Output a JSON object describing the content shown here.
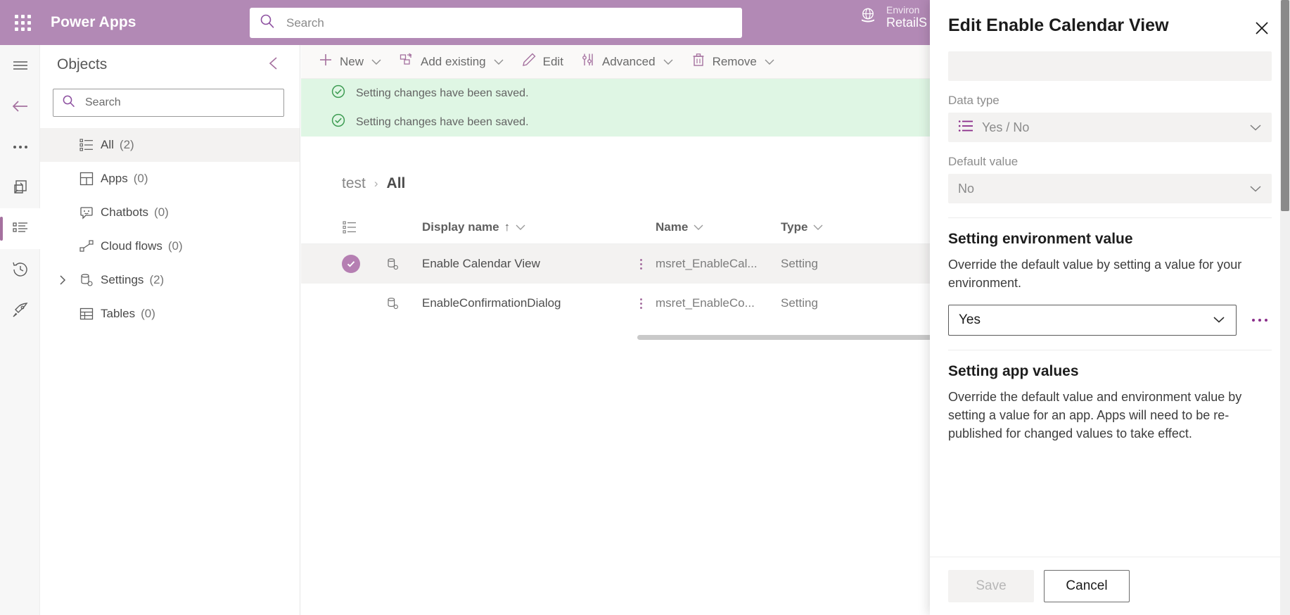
{
  "topbar": {
    "waffle_name": "app-launcher",
    "brand": "Power Apps",
    "search_placeholder": "Search",
    "search_value": "",
    "environment_label": "Environ",
    "environment_name": "RetailS",
    "accent": "#b289b5"
  },
  "rail": {
    "items": [
      {
        "name": "hamburger-menu",
        "label": "Menu"
      },
      {
        "name": "back-arrow",
        "label": "Back"
      },
      {
        "name": "more-ellipsis",
        "label": "More"
      },
      {
        "name": "solutions",
        "label": "Solutions"
      },
      {
        "name": "objects",
        "label": "Objects"
      },
      {
        "name": "history",
        "label": "History"
      },
      {
        "name": "publish-rocket",
        "label": "Publish"
      }
    ]
  },
  "objects_panel": {
    "title": "Objects",
    "collapse_icon": "chevron-left-icon",
    "search_placeholder": "Search",
    "search_value": "",
    "tree": [
      {
        "icon": "all-list-icon",
        "label": "All",
        "count": "(2)",
        "selected": true,
        "expandable": false
      },
      {
        "icon": "apps-grid-icon",
        "label": "Apps",
        "count": "(0)",
        "selected": false,
        "expandable": false
      },
      {
        "icon": "chatbot-icon",
        "label": "Chatbots",
        "count": "(0)",
        "selected": false,
        "expandable": false
      },
      {
        "icon": "cloud-flow-icon",
        "label": "Cloud flows",
        "count": "(0)",
        "selected": false,
        "expandable": false
      },
      {
        "icon": "settings-db-icon",
        "label": "Settings",
        "count": "(2)",
        "selected": false,
        "expandable": true
      },
      {
        "icon": "tables-icon",
        "label": "Tables",
        "count": "(0)",
        "selected": false,
        "expandable": false
      }
    ]
  },
  "command_bar": {
    "items": [
      {
        "icon": "plus-icon",
        "label": "New",
        "caret": true
      },
      {
        "icon": "add-existing-icon",
        "label": "Add existing",
        "caret": true
      },
      {
        "icon": "pencil-icon",
        "label": "Edit",
        "caret": false
      },
      {
        "icon": "advanced-icon",
        "label": "Advanced",
        "caret": true
      },
      {
        "icon": "trash-icon",
        "label": "Remove",
        "caret": true
      }
    ]
  },
  "notifications": [
    {
      "icon": "success-check-icon",
      "text": "Setting changes have been saved."
    },
    {
      "icon": "success-check-icon",
      "text": "Setting changes have been saved."
    }
  ],
  "breadcrumb": {
    "parent": "test",
    "separator": "›",
    "current": "All"
  },
  "grid": {
    "header_icon": "row-select-icon",
    "columns": [
      {
        "label": "Display name",
        "sort": "↑",
        "caret": true
      },
      {
        "label": "Name",
        "sort": "",
        "caret": true
      },
      {
        "label": "Type",
        "sort": "",
        "caret": true
      }
    ],
    "rows": [
      {
        "selected": true,
        "icon": "setting-record-icon",
        "display_name": "Enable Calendar View",
        "name": "msret_EnableCal...",
        "type": "Setting"
      },
      {
        "selected": false,
        "icon": "setting-record-icon",
        "display_name": "EnableConfirmationDialog",
        "name": "msret_EnableCo...",
        "type": "Setting"
      }
    ]
  },
  "panel": {
    "title": "Edit Enable Calendar View",
    "close_icon": "close-icon",
    "top_field_value": "",
    "data_type": {
      "label": "Data type",
      "icon": "yes-no-list-icon",
      "value": "Yes / No",
      "caret": "chevron-down-icon"
    },
    "default_value": {
      "label": "Default value",
      "value": "No",
      "caret": "chevron-down-icon"
    },
    "environment_section": {
      "title": "Setting environment value",
      "description": "Override the default value by setting a value for your environment.",
      "value": "Yes",
      "caret": "chevron-down-icon",
      "overflow_icon": "ellipsis-icon"
    },
    "app_section": {
      "title": "Setting app values",
      "description": "Override the default value and environment value by setting a value for an app. Apps will need to be re-published for changed values to take effect."
    },
    "footer": {
      "save_label": "Save",
      "cancel_label": "Cancel"
    }
  }
}
